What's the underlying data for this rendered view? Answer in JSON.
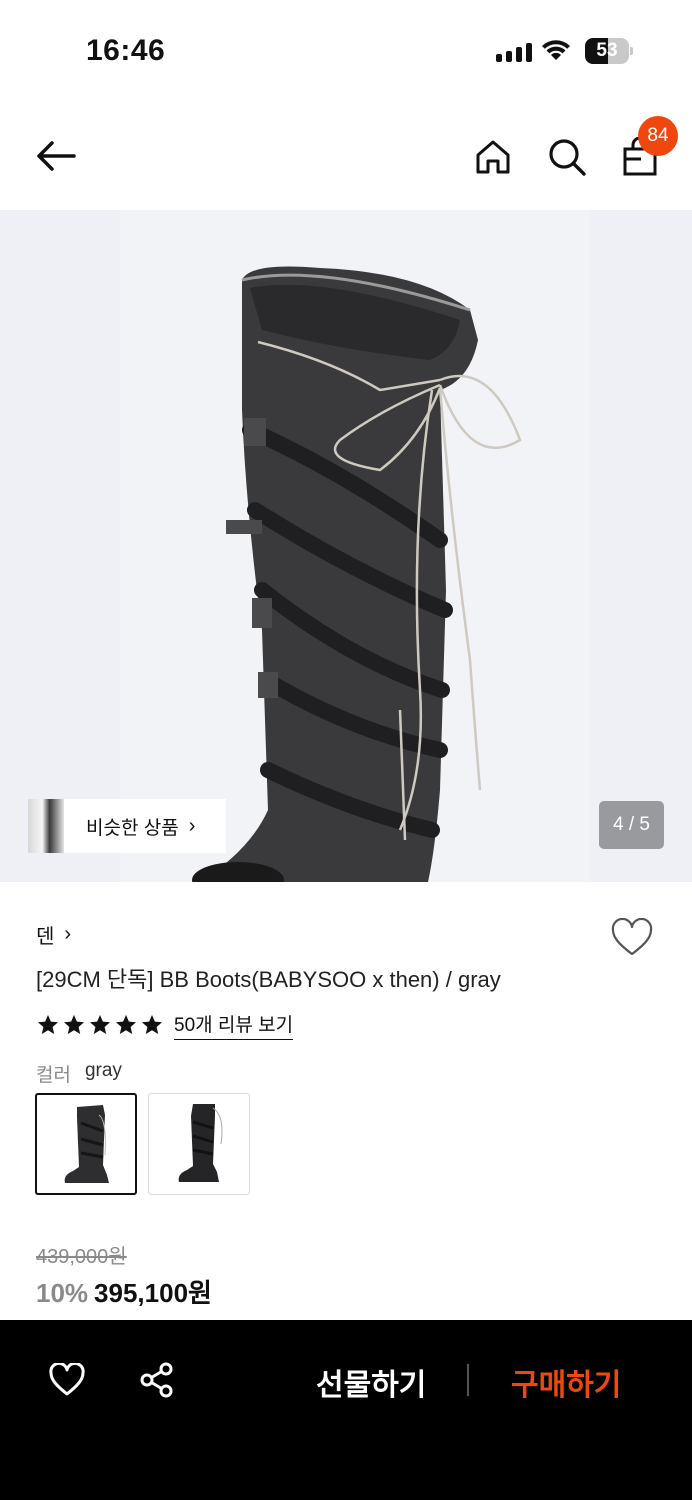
{
  "status_bar": {
    "time": "16:46",
    "battery_level": "53",
    "battery_fraction": 0.53
  },
  "nav": {
    "cart_count": "84",
    "icons": [
      "back-arrow-icon",
      "home-icon",
      "search-icon",
      "shopping-bag-icon"
    ]
  },
  "gallery": {
    "similar_label": "비슷한 상품",
    "chevron": "›",
    "page_counter": "4 / 5"
  },
  "product": {
    "brand": "덴",
    "brand_chevron": "›",
    "title": "[29CM 단독] BB Boots(BABYSOO x then) / gray",
    "rating_stars": 5,
    "review_link": "50개 리뷰 보기",
    "color_label": "컬러",
    "color_value": "gray",
    "original_price": "439,000원",
    "discount": "10%",
    "price": "395,100원"
  },
  "bottom_bar": {
    "gift_label": "선물하기",
    "buy_label": "구매하기"
  },
  "colors": {
    "accent": "#f0470f",
    "bottom_bar": "#000000",
    "hero_bg": "#eef0f5"
  }
}
